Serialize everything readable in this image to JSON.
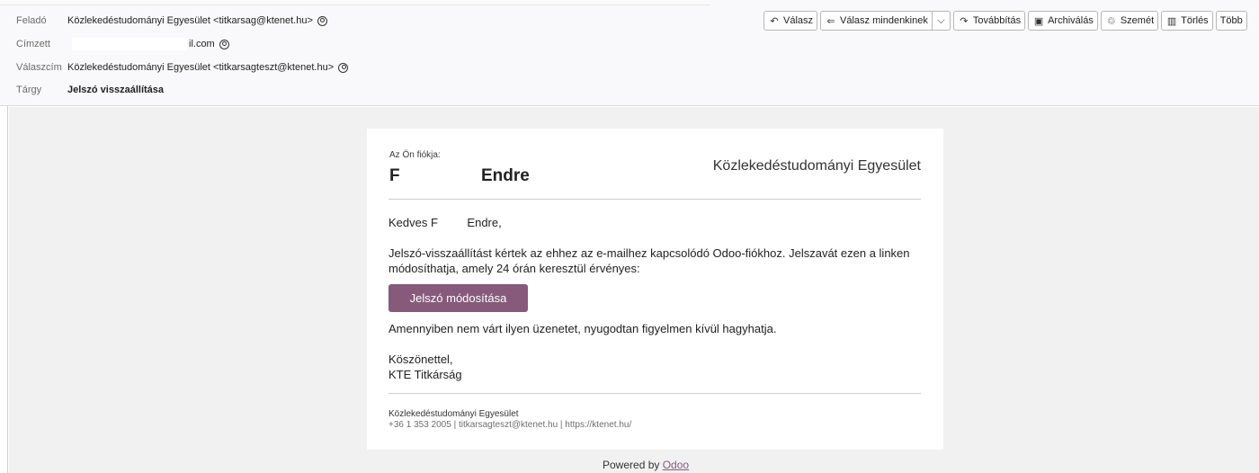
{
  "header": {
    "from_label": "Feladó",
    "from_value": "Közlekedéstudományi Egyesület <titkarsag@ktenet.hu>",
    "to_label": "Címzett",
    "to_value": "il.com",
    "reply_to_label": "Válaszcím",
    "reply_to_value": "Közlekedéstudományi Egyesület <titkarsagteszt@ktenet.hu>",
    "subject_label": "Tárgy",
    "subject_value": "Jelszó visszaállítása"
  },
  "toolbar": {
    "reply": "Válasz",
    "reply_all": "Válasz mindenkinek",
    "forward": "Továbbítás",
    "archive": "Archiválás",
    "junk": "Szemét",
    "delete": "Törlés",
    "more": "Több"
  },
  "email": {
    "account_label": "Az Ön fiókja:",
    "account_initial": "F",
    "account_name": "Endre",
    "org_name": "Közlekedéstudományi Egyesület",
    "greeting": "Kedves F         Endre,",
    "paragraph": "Jelszó-visszaállítást kértek az ehhez az e-mailhez kapcsolódó Odoo-fiókhoz. Jelszavát ezen a linken módosíthatja, amely 24 órán keresztül érvényes:",
    "button_label": "Jelszó módosítása",
    "note": "Amennyiben nem várt ilyen üzenetet, nyugodtan figyelmen kívül hagyhatja.",
    "thanks_line1": "Köszönettel,",
    "thanks_line2": "KTE Titkárság",
    "footer_org": "Közlekedéstudományi Egyesület",
    "footer_contact": "+36 1 353 2005 | titkarsagteszt@ktenet.hu | https://ktenet.hu/",
    "powered_by": "Powered by",
    "powered_link": "Odoo"
  },
  "icons": {
    "reply": "reply-icon",
    "reply_all": "reply-all-icon",
    "forward": "forward-icon",
    "archive": "archive-icon",
    "junk": "junk-icon",
    "delete": "trash-icon",
    "contact": "contact-icon"
  }
}
